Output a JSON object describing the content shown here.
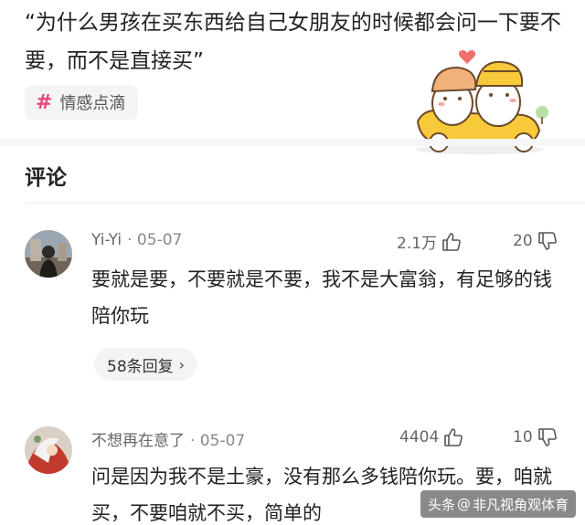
{
  "post": {
    "title": "“为什么男孩在买东西给自己女朋友的时候都会问一下要不要，而不是直接买”",
    "tag": {
      "icon": "hash-icon",
      "label": "情感点滴",
      "color": "#e8487c"
    }
  },
  "comments_section": {
    "title": "评论"
  },
  "comments": [
    {
      "user": "Yi-Yi",
      "date": "· 05-07",
      "likes": "2.1万",
      "dislikes": "20",
      "text": "要就是要，不要就是不要，我不是大富翁，有足够的钱陪你玩",
      "replies_label": "58条回复"
    },
    {
      "user": "不想再在意了",
      "date": "· 05-07",
      "likes": "4404",
      "dislikes": "10",
      "text": "问是因为我不是土豪，没有那么多钱陪你玩。要，咱就买，不要咱就不买，简单的"
    }
  ],
  "watermark": {
    "prefix": "头条",
    "at": "@",
    "handle": "非凡视角观体育"
  }
}
